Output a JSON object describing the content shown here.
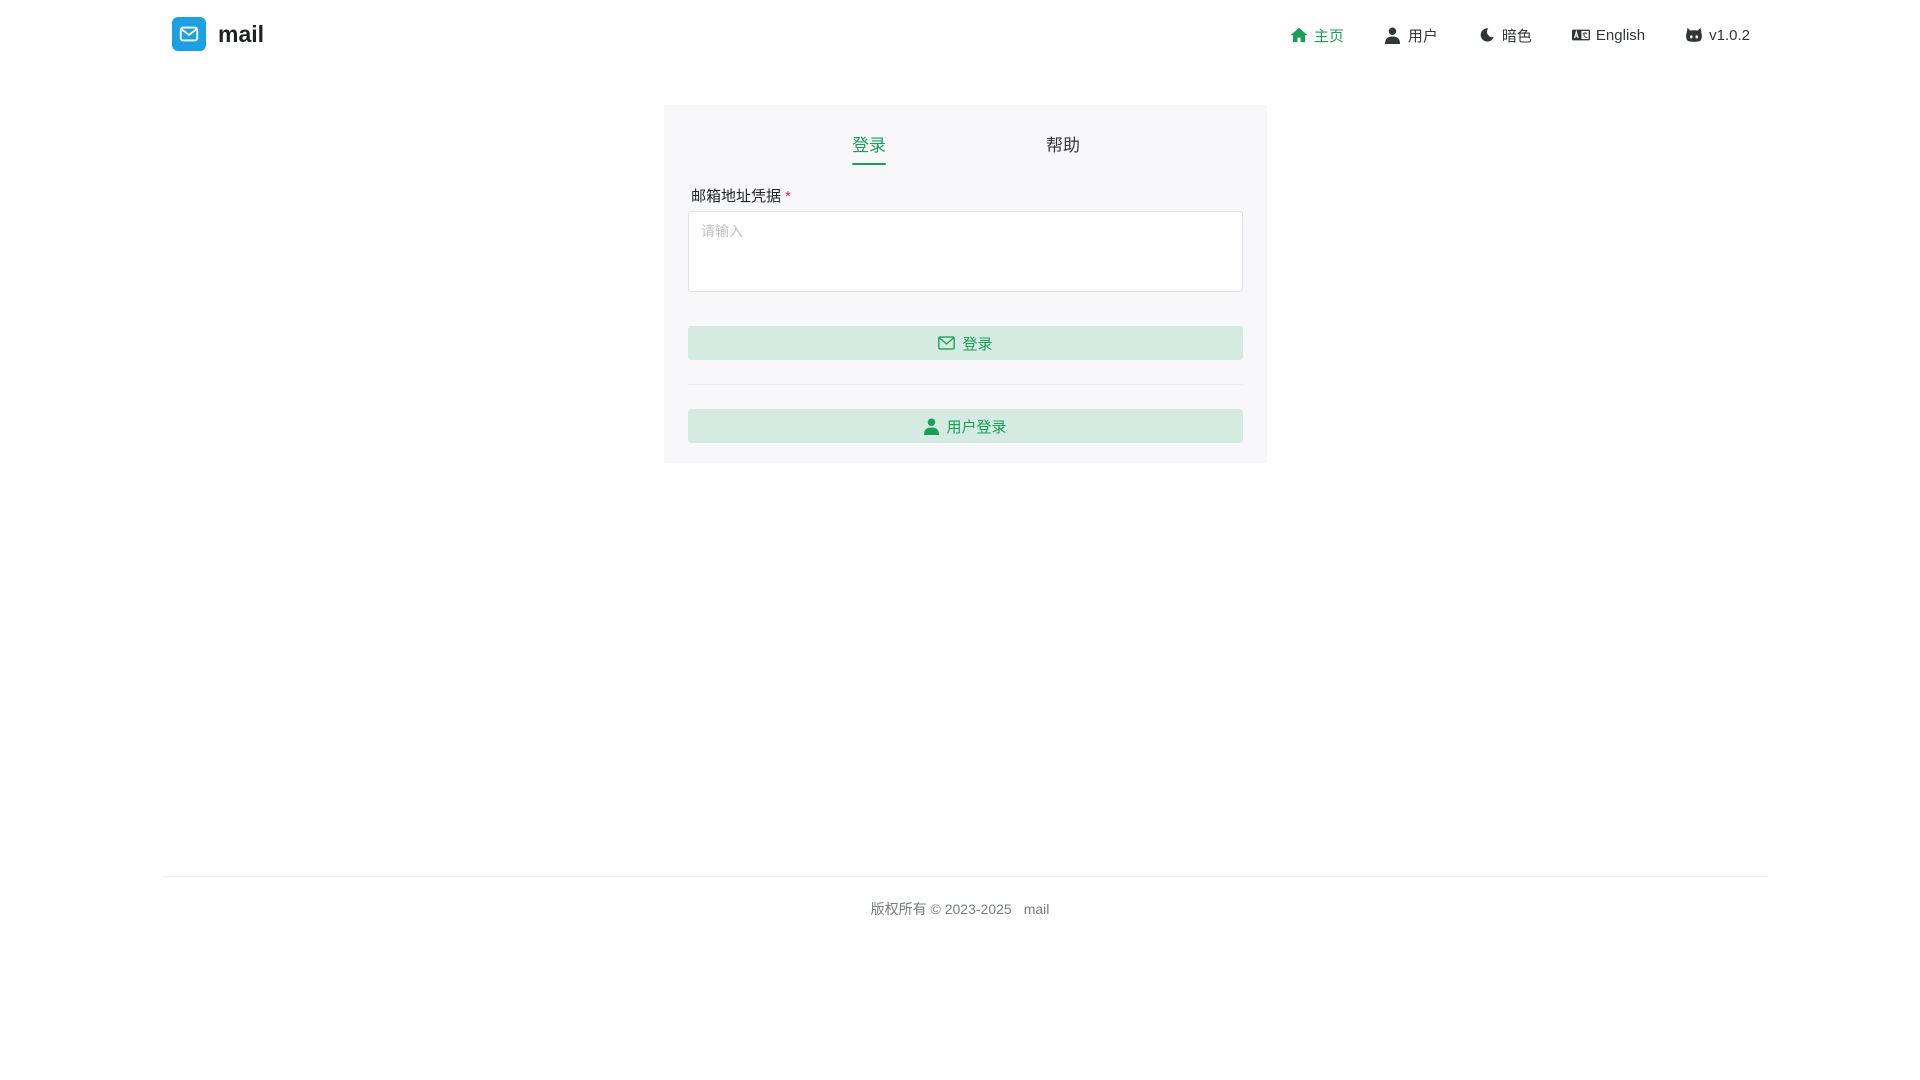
{
  "brand": {
    "name": "mail",
    "logo_icon": "mail-icon",
    "logo_color": "#1ba0e1"
  },
  "nav": {
    "items": [
      {
        "label": "主页",
        "icon": "home-icon",
        "active": true
      },
      {
        "label": "用户",
        "icon": "user-icon",
        "active": false
      },
      {
        "label": "暗色",
        "icon": "moon-icon",
        "active": false
      },
      {
        "label": "English",
        "icon": "language-icon",
        "active": false
      },
      {
        "label": "v1.0.2",
        "icon": "github-icon",
        "active": false
      }
    ]
  },
  "tabs": [
    {
      "label": "登录",
      "active": true
    },
    {
      "label": "帮助",
      "active": false
    }
  ],
  "form": {
    "credential_label": "邮箱地址凭据",
    "required_mark": "*",
    "credential_placeholder": "请输入",
    "credential_value": ""
  },
  "buttons": {
    "login_label": "登录",
    "login_icon": "envelope-icon",
    "user_login_label": "用户登录",
    "user_login_icon": "user-icon"
  },
  "footer": {
    "copyright": "版权所有 © 2023-2025",
    "app_name": "mail"
  },
  "colors": {
    "accent": "#18a058",
    "button_bg": "#d5ebe1",
    "card_bg": "#f8f8fa",
    "required": "#d03050"
  }
}
